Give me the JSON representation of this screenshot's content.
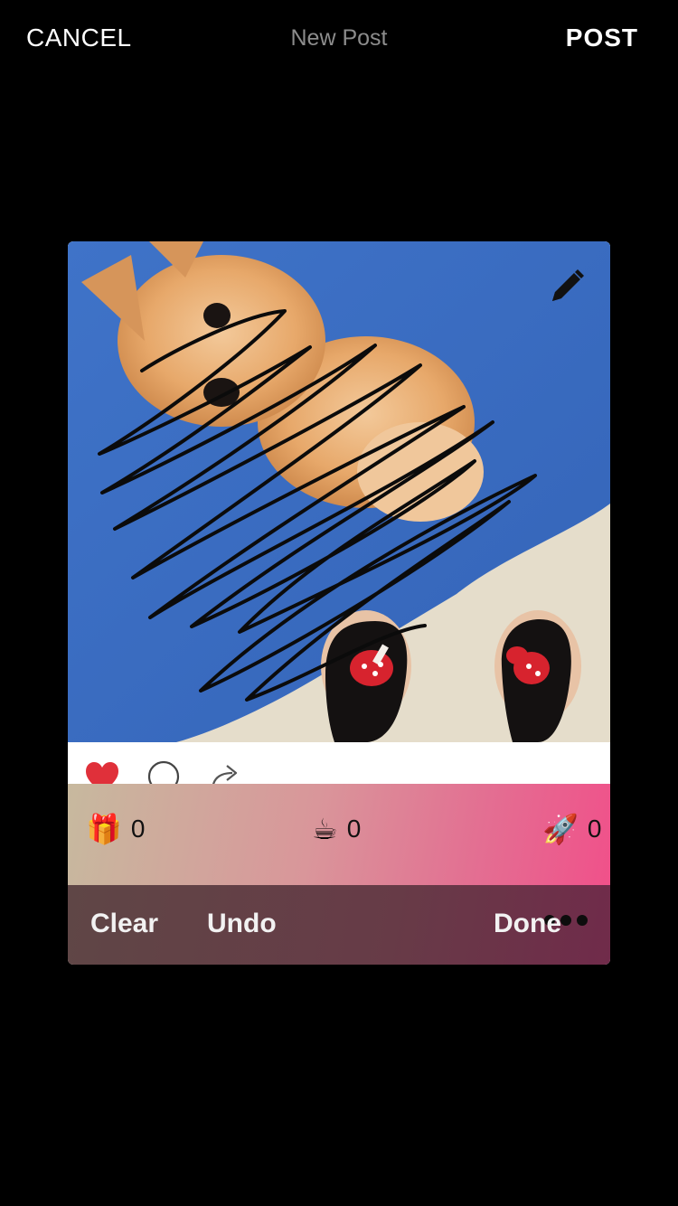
{
  "header": {
    "cancel_label": "CANCEL",
    "title": "New Post",
    "post_label": "POST"
  },
  "post": {
    "photo_icons": [
      "edit-pencil-icon"
    ],
    "action_icons": [
      "heart-icon",
      "comment-icon",
      "share-icon"
    ],
    "liked": true
  },
  "reactions": [
    {
      "icon": "gift-icon",
      "emoji": "🎁",
      "count": "0"
    },
    {
      "icon": "coffee-icon",
      "emoji": "☕",
      "count": "0"
    },
    {
      "icon": "rocket-icon",
      "emoji": "🚀",
      "count": "0"
    }
  ],
  "draw_toolbar": {
    "clear_label": "Clear",
    "undo_label": "Undo",
    "done_label": "Done",
    "more_icon": "more-dots-icon"
  },
  "colors": {
    "background": "#000000",
    "title_gray": "#8c8c8c",
    "heart_red": "#e0303a",
    "reaction_gradient_start": "#c7b99e",
    "reaction_gradient_end": "#f0518a",
    "toolbar_dark": "#673b47"
  }
}
